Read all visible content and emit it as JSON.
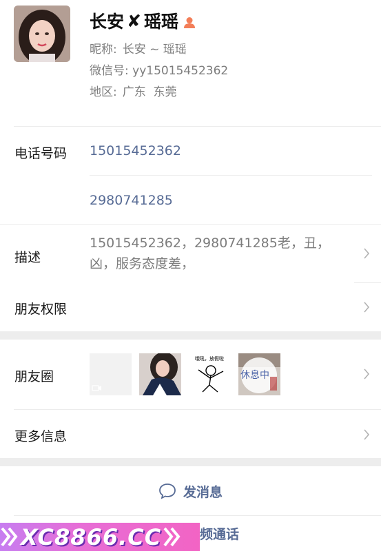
{
  "profile": {
    "name_part1": "长安",
    "name_x": "✘",
    "name_part2": "瑶瑶",
    "nickname_label": "昵称:",
    "nickname": "长安 ~ 瑶瑶",
    "wechat_label": "微信号:",
    "wechat_id": "yy15015452362",
    "region_label": "地区:",
    "region": "广东  东莞",
    "gender_icon": "female-icon",
    "gender_color": "#f37e58"
  },
  "phone": {
    "label": "电话号码",
    "numbers": [
      "15015452362",
      "2980741285"
    ]
  },
  "description": {
    "label": "描述",
    "line1": "15015452362，2980741285老，丑，",
    "line2": "凶，服务态度差，"
  },
  "permissions": {
    "label": "朋友权限"
  },
  "moments": {
    "label": "朋友圈",
    "thumb3_text": "哦吼，放假啦",
    "thumb4_text": "休息中"
  },
  "more_info": {
    "label": "更多信息"
  },
  "actions": {
    "message_label": "发消息",
    "video_call_label": "频通话"
  },
  "banner": {
    "text": "XC8866.CC"
  },
  "colors": {
    "link": "#576b95",
    "section_gap": "#ededed",
    "divider": "#ececec"
  }
}
